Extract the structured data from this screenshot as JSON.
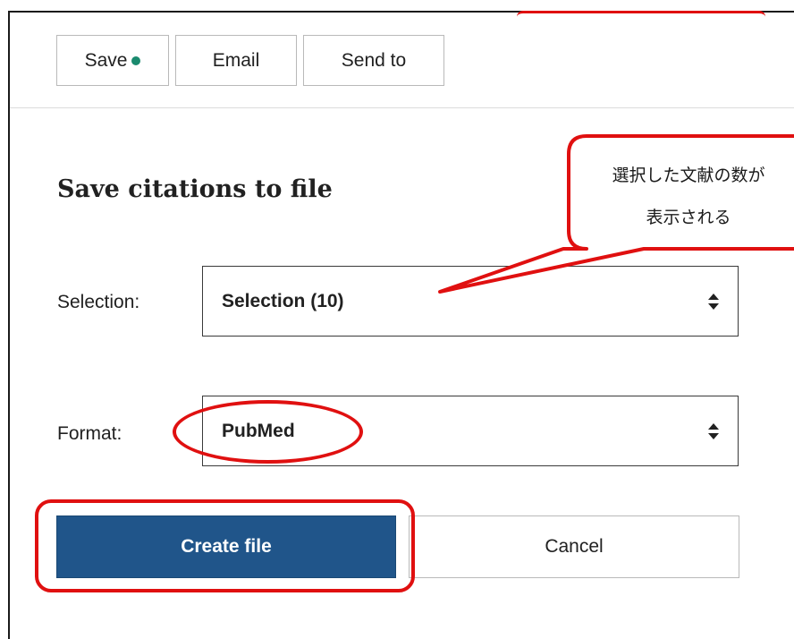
{
  "toolbar": {
    "save_label": "Save",
    "email_label": "Email",
    "send_to_label": "Send to"
  },
  "dialog": {
    "title": "Save citations to file",
    "selection": {
      "label": "Selection:",
      "value": "Selection (10)"
    },
    "format": {
      "label": "Format:",
      "value": "PubMed"
    },
    "create_label": "Create file",
    "cancel_label": "Cancel"
  },
  "annotation": {
    "line1": "選択した文献の数が",
    "line2": "表示される",
    "color": "#e01010"
  },
  "colors": {
    "primary": "#20558a",
    "saved_dot": "#1a8a6e"
  }
}
